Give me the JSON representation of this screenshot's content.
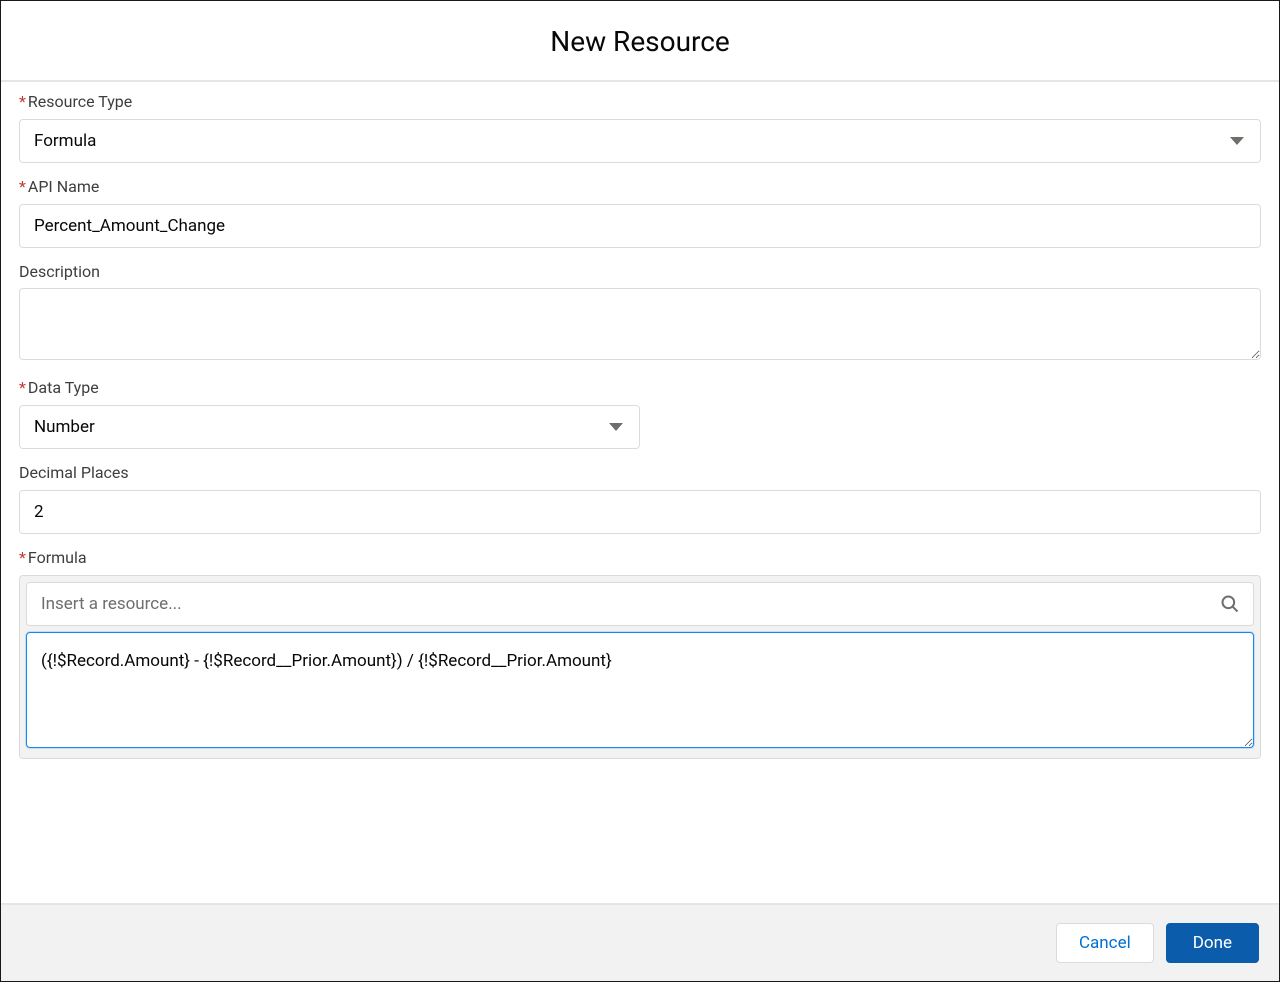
{
  "header": {
    "title": "New Resource"
  },
  "form": {
    "resourceType": {
      "label": "Resource Type",
      "value": "Formula"
    },
    "apiName": {
      "label": "API Name",
      "value": "Percent_Amount_Change"
    },
    "description": {
      "label": "Description",
      "value": ""
    },
    "dataType": {
      "label": "Data Type",
      "value": "Number"
    },
    "decimalPlaces": {
      "label": "Decimal Places",
      "value": "2"
    },
    "formula": {
      "label": "Formula",
      "insertPlaceholder": "Insert a resource...",
      "expression": "({!$Record.Amount} - {!$Record__Prior.Amount}) / {!$Record__Prior.Amount}"
    }
  },
  "footer": {
    "cancel": "Cancel",
    "done": "Done"
  }
}
